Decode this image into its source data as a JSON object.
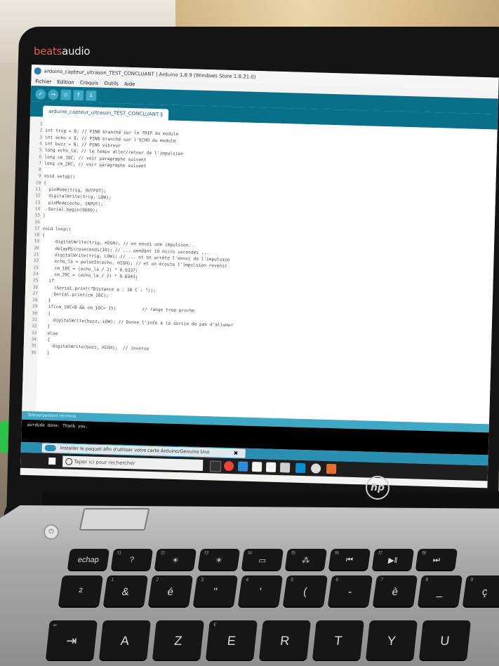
{
  "brand": {
    "prefix": "beats",
    "suffix": "audio"
  },
  "window": {
    "title": "arduino_capteur_ultrason_TEST_CONCLUANT | Arduino 1.8.9 (Windows Store 1.8.21.0)",
    "menu": [
      "Fichier",
      "Edition",
      "Croquis",
      "Outils",
      "Aide"
    ]
  },
  "tab": {
    "label": "arduino_capteur_ultrason_TEST_CONCLUANT §"
  },
  "code": [
    {
      "n": "1",
      "t": ""
    },
    {
      "n": "2",
      "t": "int trig = 8; // PIN8 branché sur le TRIP du module"
    },
    {
      "n": "3",
      "t": "int echo = 8; // PIN8 branché sur l'ECHO du module"
    },
    {
      "n": "4",
      "t": "int buzz = 6; // PIN6 vibreur"
    },
    {
      "n": "5",
      "t": "long echo_la; // le temps aller/retour de l'impulsion"
    },
    {
      "n": "6",
      "t": "long cm_10C; // voir paragraphe suivant"
    },
    {
      "n": "7",
      "t": "long cm_20C; // voir paragraphe suivant"
    },
    {
      "n": "8",
      "t": ""
    },
    {
      "n": "9",
      "t": "void setup()"
    },
    {
      "n": "10",
      "t": "{"
    },
    {
      "n": "11",
      "t": "  pinMode(trig, OUTPUT);"
    },
    {
      "n": "12",
      "t": "  digitalWrite(trig, LOW);"
    },
    {
      "n": "13",
      "t": "  pinMode(echo, INPUT);"
    },
    {
      "n": "14",
      "t": "  Serial.begin(9600);"
    },
    {
      "n": "15",
      "t": "}"
    },
    {
      "n": "16",
      "t": ""
    },
    {
      "n": "17",
      "t": "void loop()"
    },
    {
      "n": "18",
      "t": "{"
    },
    {
      "n": "19",
      "t": "     digitalWrite(trig, HIGH); // on envoi une impulsion..."
    },
    {
      "n": "20",
      "t": "     delayMicroseconds(10); // ... pendant 10 micro secondes ..."
    },
    {
      "n": "21",
      "t": "     digitalWrite(trig, LOW); // ... et on arrête l'envoi de l'impulsion"
    },
    {
      "n": "22",
      "t": "     echo_la = pulseIn(echo, HIGH); // et on écoute l'impulsion revenir"
    },
    {
      "n": "23",
      "t": "     cm_10C = (echo_la / 2) * 0.0337;"
    },
    {
      "n": "24",
      "t": "     cm_20C = (echo_la / 2) * 0.0343;"
    },
    {
      "n": "25",
      "t": "   if"
    },
    {
      "n": "26",
      "t": "     (Serial.print(\"Distance a : 10 C : \"));"
    },
    {
      "n": "27",
      "t": "     Serial.print(cm_10C);"
    },
    {
      "n": "28",
      "t": "   }"
    },
    {
      "n": "29",
      "t": "   if(cm_10C<8 && cm_10C> 15)          // range trop proche"
    },
    {
      "n": "30",
      "t": "   {"
    },
    {
      "n": "31",
      "t": "     digitalWrite(buzz, LOW); // Donne l'info à la sortie de pas d'allumer"
    },
    {
      "n": "32",
      "t": "   }"
    },
    {
      "n": "33",
      "t": "   else"
    },
    {
      "n": "34",
      "t": "   {"
    },
    {
      "n": "35",
      "t": "     digitalWrite(buzz, HIGH);  // inverse"
    },
    {
      "n": "36",
      "t": "   }"
    }
  ],
  "status": {
    "text": "Téléversement terminé"
  },
  "console": {
    "text": "avrdude done.  Thank you."
  },
  "notification": {
    "text": "Installer le paquet afin d'utiliser votre carte Arduino/Genuino Uno",
    "close": "✖"
  },
  "taskbar": {
    "search_placeholder": "Taper ici pour rechercher"
  },
  "keyboard": {
    "row1": [
      {
        "main": "echap",
        "sub": ""
      },
      {
        "main": "?",
        "sub": "f1"
      },
      {
        "main": "☀",
        "sub": "f2"
      },
      {
        "main": "☀",
        "sub": "f3"
      },
      {
        "main": "▭",
        "sub": "f4"
      },
      {
        "main": "⁂",
        "sub": "f5"
      },
      {
        "main": "⏮",
        "sub": "f6"
      },
      {
        "main": "▶ǁ",
        "sub": "f7"
      },
      {
        "main": "⏭",
        "sub": "f8"
      }
    ],
    "row2": [
      {
        "main": "²",
        "sub": ""
      },
      {
        "main": "&",
        "sub": "1"
      },
      {
        "main": "é",
        "sub": "2"
      },
      {
        "main": "\"",
        "sub": "3"
      },
      {
        "main": "'",
        "sub": "4"
      },
      {
        "main": "(",
        "sub": "5"
      },
      {
        "main": "-",
        "sub": "6"
      },
      {
        "main": "è",
        "sub": "7"
      },
      {
        "main": "_",
        "sub": "8"
      },
      {
        "main": "ç",
        "sub": "9"
      }
    ],
    "row3": [
      {
        "main": "⇥",
        "sub": "⇤"
      },
      {
        "main": "A",
        "sub": ""
      },
      {
        "main": "Z",
        "sub": ""
      },
      {
        "main": "E",
        "sub": "€"
      },
      {
        "main": "R",
        "sub": ""
      },
      {
        "main": "T",
        "sub": ""
      },
      {
        "main": "Y",
        "sub": ""
      },
      {
        "main": "U",
        "sub": ""
      }
    ]
  }
}
